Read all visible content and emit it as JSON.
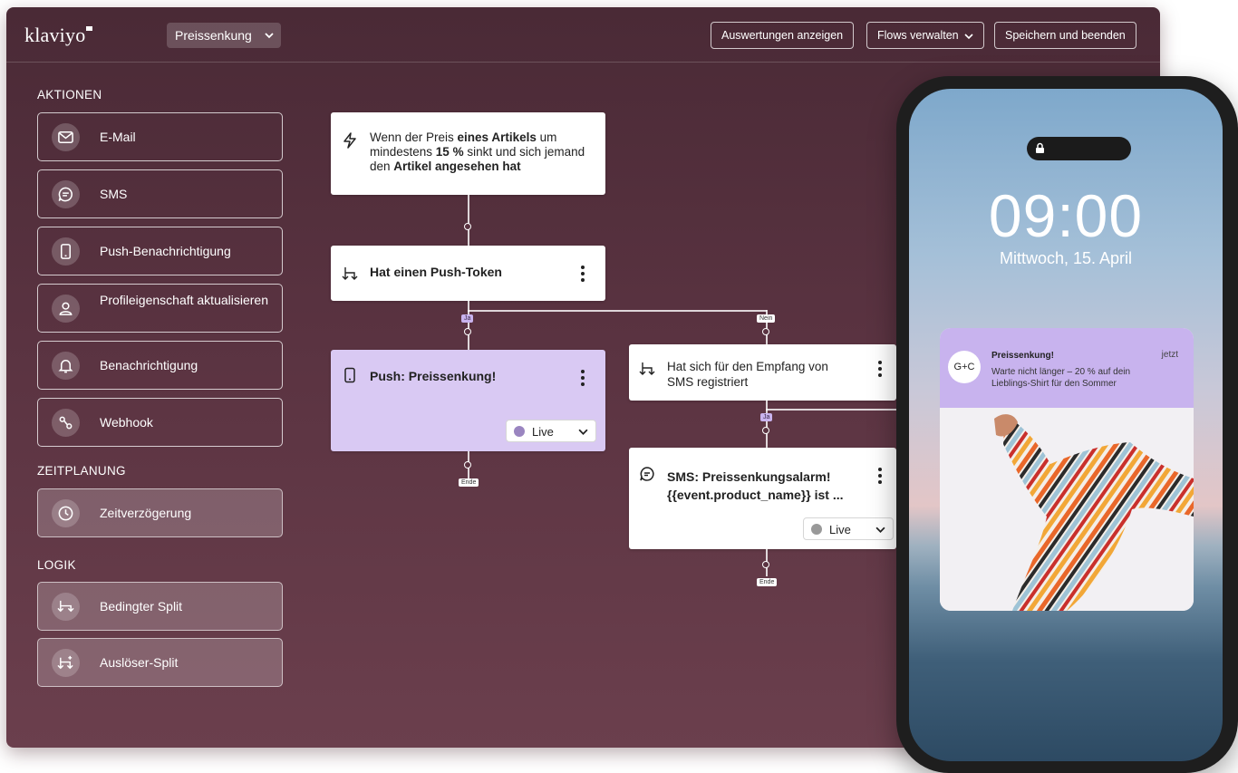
{
  "app": {
    "logo": "klaviyo",
    "flow_selector": "Preissenkung",
    "buttons": {
      "reports": "Auswertungen anzeigen",
      "manage_flows": "Flows verwalten",
      "save_exit": "Speichern und beenden"
    }
  },
  "sidebar": {
    "actions_title": "AKTIONEN",
    "actions": [
      {
        "label": "E-Mail",
        "icon": "mail-icon"
      },
      {
        "label": "SMS",
        "icon": "chat-icon"
      },
      {
        "label": "Push-Benachrichtigung",
        "icon": "phone-icon"
      },
      {
        "label": "Profileigenschaft aktualisieren",
        "icon": "person-icon"
      },
      {
        "label": "Benachrichtigung",
        "icon": "bell-icon"
      },
      {
        "label": "Webhook",
        "icon": "webhook-icon"
      }
    ],
    "timing_title": "ZEITPLANUNG",
    "timing": [
      {
        "label": "Zeitverzögerung",
        "icon": "clock-icon"
      }
    ],
    "logic_title": "LOGIK",
    "logic": [
      {
        "label": "Bedingter Split",
        "icon": "split-icon"
      },
      {
        "label": "Auslöser-Split",
        "icon": "trigger-split-icon"
      }
    ]
  },
  "flow": {
    "trigger": {
      "p1": "Wenn der Preis ",
      "b1": "eines Artikels",
      "p2": " um mindestens ",
      "b2": "15 %",
      "p3": " sinkt und sich jemand den ",
      "b3": "Artikel angesehen hat"
    },
    "push_token": "Hat einen Push-Token",
    "yes": "Ja",
    "no": "Nein",
    "push_action": "Push: Preissenkung!",
    "live": "Live",
    "end": "Ende",
    "sms_check": "Hat sich für den Empfang von SMS registriert",
    "sms_action": "SMS: Preissenkungsalarm! {{event.product_name}} ist ..."
  },
  "phone": {
    "time": "09:00",
    "date": "Mittwoch, 15. April",
    "notification": {
      "avatar": "G+C",
      "title": "Preissenkung!",
      "time": "jetzt",
      "body": "Warte nicht länger – 20 % auf dein Lieblings-Shirt für den Sommer"
    }
  },
  "colors": {
    "app_bg": "#5a3341",
    "accent_purple": "#d9c9f3",
    "notification_head": "#c8b3ee"
  }
}
